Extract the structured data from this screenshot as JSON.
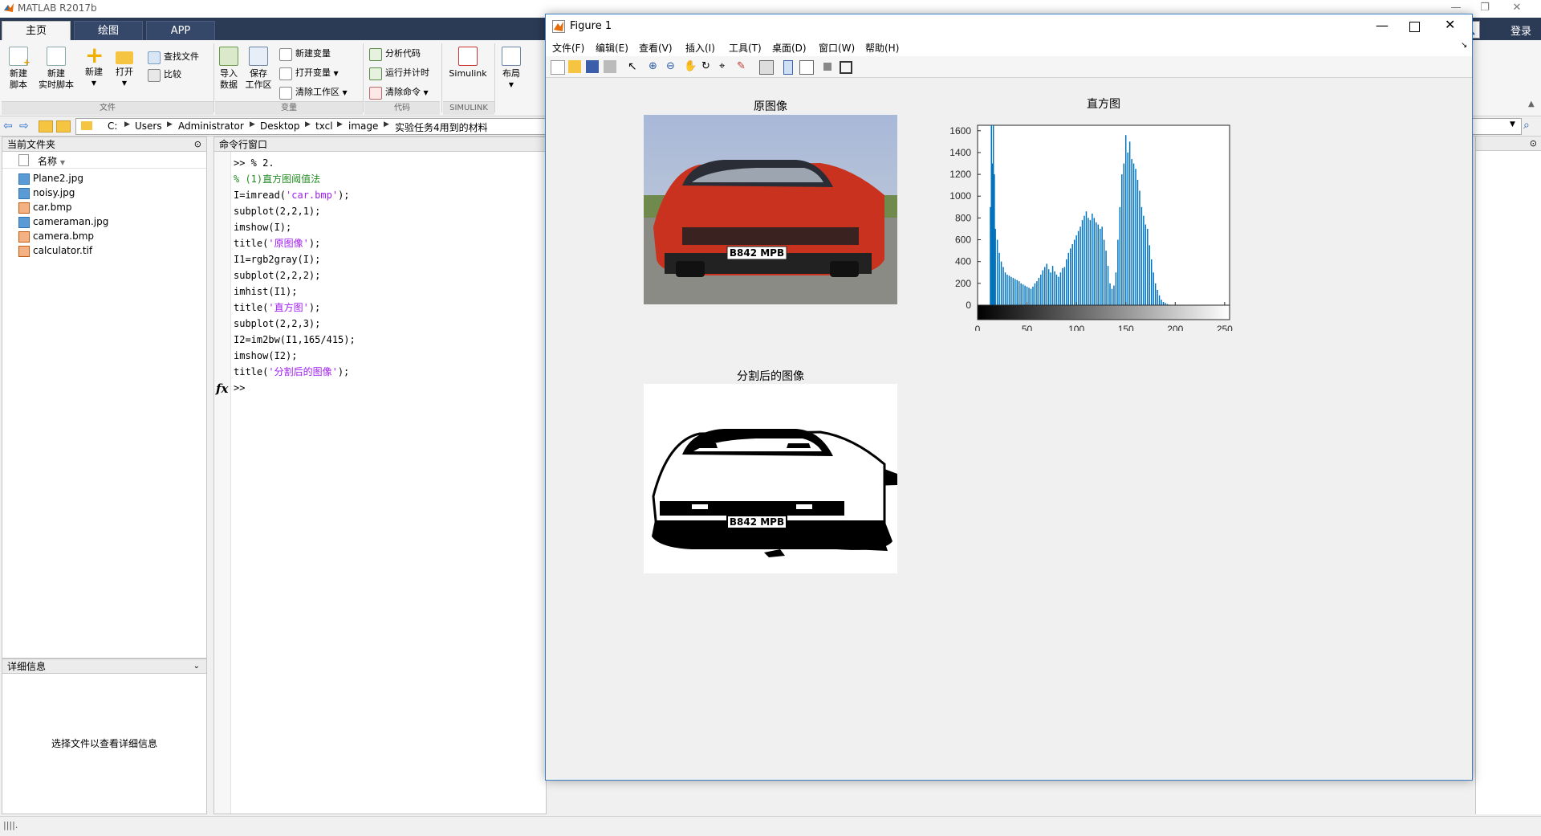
{
  "app": {
    "title": "MATLAB R2017b",
    "login": "登录"
  },
  "tabs": [
    "主页",
    "绘图",
    "APP"
  ],
  "ribbon": {
    "new_script": [
      "新建",
      "脚本"
    ],
    "new_live_script": [
      "新建",
      "实时脚本"
    ],
    "new": "新建",
    "open": "打开",
    "find_files": "查找文件",
    "compare": "比较",
    "import_data": [
      "导入",
      "数据"
    ],
    "save_workspace": [
      "保存",
      "工作区"
    ],
    "new_variable": "新建变量",
    "open_variable": "打开变量",
    "clear_workspace": "清除工作区",
    "analyze_code": "分析代码",
    "run_and_time": "运行并计时",
    "clear_commands": "清除命令",
    "simulink": "Simulink",
    "layout": "布局",
    "groups": {
      "file": "文件",
      "variable": "变量",
      "code": "代码",
      "simulink": "SIMULINK"
    }
  },
  "address": {
    "crumbs": [
      "C:",
      "Users",
      "Administrator",
      "Desktop",
      "txcl",
      "image",
      "实验任务4用到的材料"
    ]
  },
  "current_folder": {
    "title": "当前文件夹",
    "column_name": "名称",
    "files": [
      {
        "name": "Plane2.jpg",
        "icon": "image-file-icon"
      },
      {
        "name": "noisy.jpg",
        "icon": "image-file-icon"
      },
      {
        "name": "car.bmp",
        "icon": "bitmap-file-icon"
      },
      {
        "name": "cameraman.jpg",
        "icon": "image-file-icon"
      },
      {
        "name": "camera.bmp",
        "icon": "bitmap-file-icon"
      },
      {
        "name": "calculator.tif",
        "icon": "bitmap-file-icon"
      }
    ]
  },
  "details": {
    "title": "详细信息",
    "hint": "选择文件以查看详细信息"
  },
  "command_window": {
    "title": "命令行窗口",
    "lines": [
      {
        "text": ">> % 2.",
        "style": "normal"
      },
      {
        "text": "% (1)直方图阈值法",
        "style": "green"
      },
      {
        "pre": "I=imread(",
        "str": "'car.bmp'",
        "post": ");"
      },
      {
        "text": "subplot(2,2,1);",
        "style": "normal"
      },
      {
        "text": "imshow(I);",
        "style": "normal"
      },
      {
        "pre": "title(",
        "str": "'原图像'",
        "post": ");"
      },
      {
        "text": "I1=rgb2gray(I);",
        "style": "normal"
      },
      {
        "text": "subplot(2,2,2);",
        "style": "normal"
      },
      {
        "text": "imhist(I1);",
        "style": "normal"
      },
      {
        "pre": "title(",
        "str": "'直方图'",
        "post": ");"
      },
      {
        "text": "subplot(2,2,3);",
        "style": "normal"
      },
      {
        "text": "I2=im2bw(I1,165/415);",
        "style": "normal"
      },
      {
        "text": "imshow(I2);",
        "style": "normal"
      },
      {
        "pre": "title(",
        "str": "'分割后的图像'",
        "post": ");"
      }
    ],
    "prompt": ">>",
    "fx": "fx"
  },
  "figure": {
    "title": "Figure 1",
    "menu": [
      "文件(F)",
      "编辑(E)",
      "查看(V)",
      "插入(I)",
      "工具(T)",
      "桌面(D)",
      "窗口(W)",
      "帮助(H)"
    ],
    "original_title": "原图像",
    "hist_title": "直方图",
    "seg_title": "分割后的图像",
    "plate_text": "B842 MPB"
  },
  "chart_data": {
    "type": "bar",
    "title": "直方图",
    "xlabel": "",
    "ylabel": "",
    "xlim": [
      0,
      255
    ],
    "ylim": [
      0,
      1650
    ],
    "xticks": [
      0,
      50,
      100,
      150,
      200,
      250
    ],
    "yticks": [
      0,
      200,
      400,
      600,
      800,
      1000,
      1200,
      1400,
      1600
    ],
    "bar_color": "#0072bd",
    "x": [
      13,
      14,
      15,
      16,
      17,
      18,
      20,
      22,
      24,
      26,
      28,
      30,
      32,
      34,
      36,
      38,
      40,
      42,
      44,
      46,
      48,
      50,
      52,
      54,
      56,
      58,
      60,
      62,
      64,
      66,
      68,
      70,
      72,
      74,
      76,
      78,
      80,
      82,
      84,
      86,
      88,
      90,
      92,
      94,
      96,
      98,
      100,
      102,
      104,
      106,
      108,
      110,
      112,
      114,
      116,
      118,
      120,
      122,
      124,
      126,
      128,
      130,
      132,
      134,
      136,
      138,
      140,
      142,
      144,
      146,
      148,
      150,
      152,
      154,
      156,
      158,
      160,
      162,
      164,
      166,
      168,
      170,
      172,
      174,
      176,
      178,
      180,
      182,
      184,
      186,
      188,
      190,
      192,
      194,
      196,
      198,
      200,
      202,
      204,
      206,
      208,
      210,
      212,
      214,
      216,
      218,
      220,
      222
    ],
    "values": [
      900,
      1650,
      1300,
      1650,
      1200,
      700,
      600,
      480,
      400,
      350,
      300,
      280,
      270,
      260,
      250,
      240,
      230,
      220,
      200,
      190,
      180,
      170,
      160,
      150,
      170,
      200,
      220,
      250,
      280,
      320,
      350,
      380,
      330,
      300,
      360,
      310,
      280,
      260,
      300,
      340,
      350,
      420,
      480,
      520,
      560,
      600,
      640,
      680,
      720,
      780,
      820,
      860,
      800,
      780,
      840,
      800,
      760,
      740,
      700,
      720,
      600,
      500,
      360,
      200,
      150,
      180,
      300,
      600,
      900,
      1200,
      1300,
      1560,
      1400,
      1500,
      1340,
      1300,
      1250,
      1150,
      1050,
      900,
      820,
      740,
      700,
      550,
      420,
      300,
      200,
      140,
      90,
      50,
      30,
      20,
      10,
      5,
      3,
      2,
      1,
      1,
      1,
      1,
      1,
      1,
      0,
      0,
      0,
      0,
      0,
      0
    ]
  }
}
